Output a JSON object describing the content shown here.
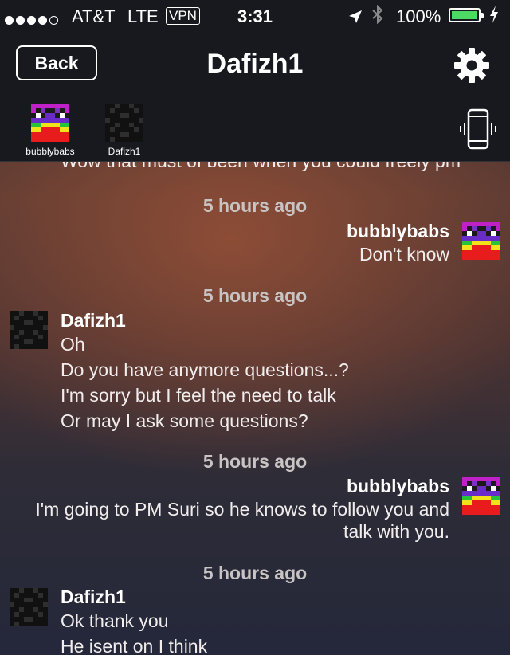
{
  "status_bar": {
    "carrier": "AT&T",
    "network": "LTE",
    "vpn": "VPN",
    "time": "3:31",
    "battery": "100%",
    "battery_level": 1.0,
    "battery_color": "#4cd964"
  },
  "nav": {
    "back_label": "Back",
    "title": "Dafizh1",
    "settings_icon": "gear-icon"
  },
  "participants": [
    {
      "name": "bubblybabs",
      "avatar": "rainbow-pixel-face"
    },
    {
      "name": "Dafizh1",
      "avatar": "dark-pixel-face"
    }
  ],
  "header_icons": {
    "vibrate": "phone-vibrate-icon"
  },
  "messages": {
    "partial_line": "Wow that must of been when you could freely pm",
    "blocks": [
      {
        "timestamp": "5 hours ago",
        "sender": "bubblybabs",
        "side": "right",
        "lines": [
          "Don't know"
        ]
      },
      {
        "timestamp": "5 hours ago",
        "sender": "Dafizh1",
        "side": "left",
        "lines": [
          "Oh",
          "Do you have anymore questions...?",
          "I'm sorry but I feel the need to talk",
          "Or may I ask some questions?"
        ]
      },
      {
        "timestamp": "5 hours ago",
        "sender": "bubblybabs",
        "side": "right",
        "lines": [
          "I'm going to PM Suri so he knows to follow you and",
          "talk with you."
        ]
      },
      {
        "timestamp": "5 hours ago",
        "sender": "Dafizh1",
        "side": "left",
        "lines": [
          "Ok thank you",
          "He isent on I think"
        ]
      }
    ]
  }
}
